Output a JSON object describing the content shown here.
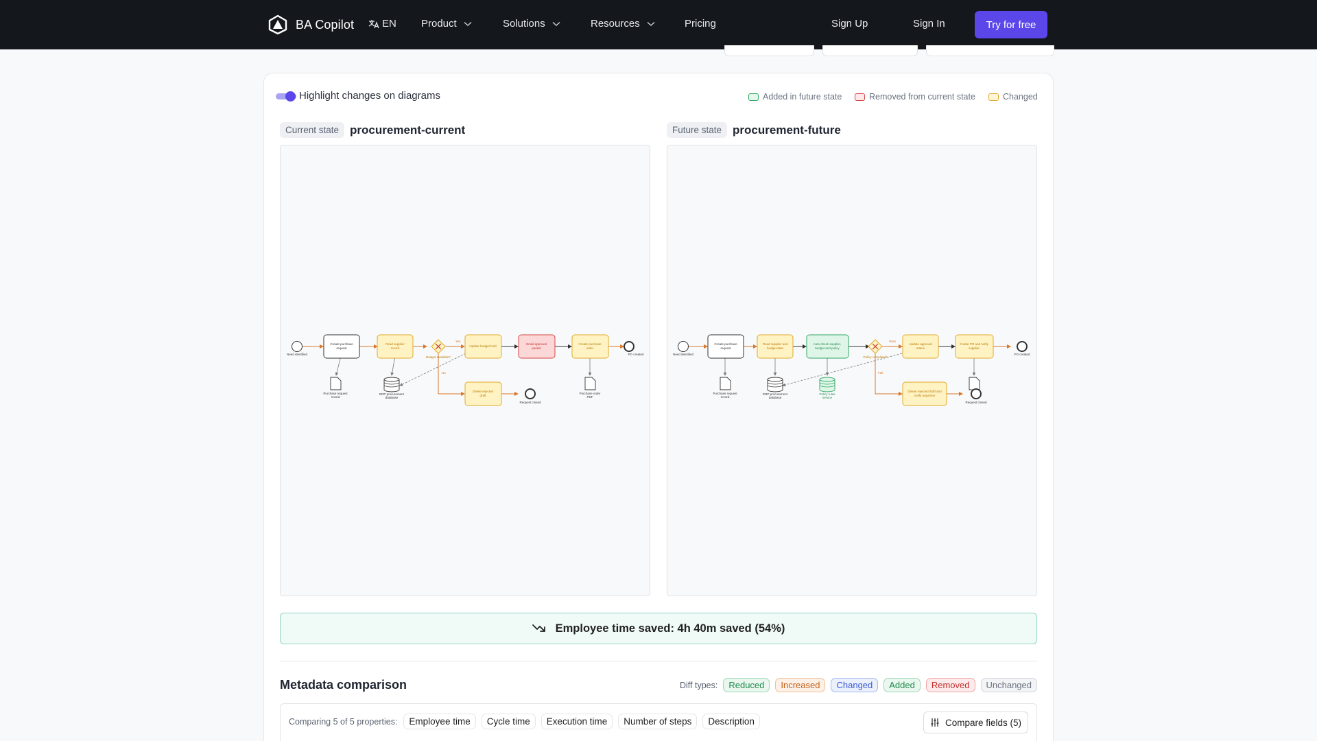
{
  "nav": {
    "brand": "BA Copilot",
    "lang": "EN",
    "items": [
      {
        "label": "Product"
      },
      {
        "label": "Solutions"
      },
      {
        "label": "Resources"
      }
    ],
    "pricing": "Pricing",
    "sign_up": "Sign Up",
    "sign_in": "Sign In",
    "cta": "Try for free"
  },
  "colors": {
    "brand_accent": "#5b46ea",
    "added": "#1f9d55",
    "removed": "#d64545",
    "changed": "#e0a92a"
  },
  "toolbar": {
    "highlight_label": "Highlight changes on diagrams",
    "highlight_on": true,
    "legend": {
      "added": "Added in future state",
      "removed": "Removed from current state",
      "changed": "Changed"
    }
  },
  "current": {
    "tag": "Current state",
    "title": "procurement-current",
    "diagram": {
      "start": "Need identified",
      "task_create_request": "Create purchase request",
      "doc_purchase_request": "Purchase request record",
      "task_read_supplier": "Read supplier record",
      "db_erp": "ERP procurement database",
      "gateway": "Budget available?",
      "flow_yes": "Yes",
      "flow_no": "No",
      "task_update_budget": "Update budget hold",
      "task_email": "Email approval packet",
      "task_create_po": "Create purchase order",
      "doc_po_pdf": "Purchase order PDF",
      "end_po": "PO created",
      "task_delete": "Delete rejected draft",
      "end_rejected": "Request closed"
    }
  },
  "future": {
    "tag": "Future state",
    "title": "procurement-future",
    "diagram": {
      "start": "Need identified",
      "task_create_request": "Create purchase request",
      "doc_purchase_request": "Purchase request record",
      "task_read_supplier": "Read supplier and budget data",
      "db_erp": "ERP procurement database",
      "task_autocheck": "Auto-check supplier, budget and policy",
      "db_policy": "Policy rules service",
      "gateway": "Policy compliant?",
      "flow_pass": "Pass",
      "flow_fail": "Fail",
      "task_update_status": "Update approval status",
      "task_create_po": "Create PO and notify supplier",
      "end_po": "PO created",
      "task_delete_notify": "Delete rejected draft and notify requester",
      "end_rejected": "Request closed"
    }
  },
  "savings": {
    "text": "Employee time saved: 4h 40m saved (54%)"
  },
  "metadata": {
    "title": "Metadata comparison",
    "diff_label": "Diff types:",
    "diff_types": [
      {
        "label": "Reduced",
        "color": "#1f8a4c",
        "bg": "#e9f7ee",
        "border": "#9fd6b4"
      },
      {
        "label": "Increased",
        "color": "#c2621b",
        "bg": "#fdf0e6",
        "border": "#efbf98"
      },
      {
        "label": "Changed",
        "color": "#3a58d6",
        "bg": "#ebf0fd",
        "border": "#a7b7ee"
      },
      {
        "label": "Added",
        "color": "#1f8a4c",
        "bg": "#e9f7ee",
        "border": "#9fd6b4"
      },
      {
        "label": "Removed",
        "color": "#c23030",
        "bg": "#fdeaea",
        "border": "#eea5a5"
      },
      {
        "label": "Unchanged",
        "color": "#6b7280",
        "bg": "#f3f4f6",
        "border": "#d3d6dc"
      }
    ],
    "compare_label": "Comparing 5 of 5 properties:",
    "properties": [
      "Employee time",
      "Cycle time",
      "Execution time",
      "Number of steps",
      "Description"
    ],
    "compare_button": "Compare fields (5)"
  }
}
